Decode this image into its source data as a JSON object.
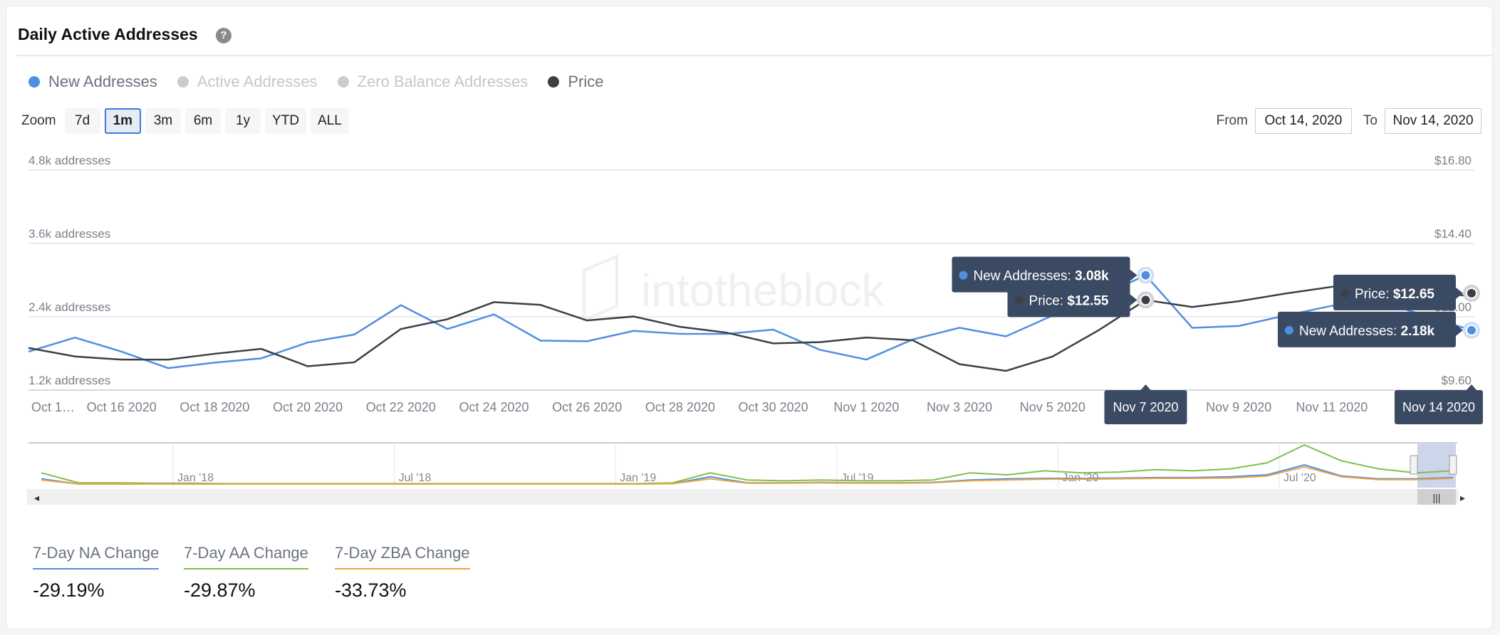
{
  "header": {
    "title": "Daily Active Addresses",
    "help_icon": "question-circle-icon"
  },
  "legend": [
    {
      "label": "New Addresses",
      "color": "#4f8fe0",
      "active": true
    },
    {
      "label": "Active Addresses",
      "color": "#cccccc",
      "active": false
    },
    {
      "label": "Zero Balance Addresses",
      "color": "#cccccc",
      "active": false
    },
    {
      "label": "Price",
      "color": "#3c3f44",
      "active": true
    }
  ],
  "legend_text": {
    "active": "#6b7380",
    "inactive": "#c4c7cc"
  },
  "zoom": {
    "label": "Zoom",
    "options": [
      "7d",
      "1m",
      "3m",
      "6m",
      "1y",
      "YTD",
      "ALL"
    ],
    "selected": "1m"
  },
  "range": {
    "from_label": "From",
    "from": "Oct 14, 2020",
    "to_label": "To",
    "to": "Nov 14, 2020"
  },
  "watermark": "intotheblock",
  "chart_data": {
    "type": "line",
    "x": [
      "Oct 14 2020",
      "Oct 15 2020",
      "Oct 16 2020",
      "Oct 17 2020",
      "Oct 18 2020",
      "Oct 19 2020",
      "Oct 20 2020",
      "Oct 21 2020",
      "Oct 22 2020",
      "Oct 23 2020",
      "Oct 24 2020",
      "Oct 25 2020",
      "Oct 26 2020",
      "Oct 27 2020",
      "Oct 28 2020",
      "Oct 29 2020",
      "Oct 30 2020",
      "Oct 31 2020",
      "Nov 1 2020",
      "Nov 2 2020",
      "Nov 3 2020",
      "Nov 4 2020",
      "Nov 5 2020",
      "Nov 6 2020",
      "Nov 7 2020",
      "Nov 8 2020",
      "Nov 9 2020",
      "Nov 10 2020",
      "Nov 11 2020",
      "Nov 12 2020",
      "Nov 13 2020",
      "Nov 14 2020"
    ],
    "x_tick_labels": [
      "Oct 1…",
      "Oct 16 2020",
      "Oct 18 2020",
      "Oct 20 2020",
      "Oct 22 2020",
      "Oct 24 2020",
      "Oct 26 2020",
      "Oct 28 2020",
      "Oct 30 2020",
      "Nov 1 2020",
      "Nov 3 2020",
      "Nov 5 2020",
      "Nov 7 2020",
      "Nov 9 2020",
      "Nov 11 2020",
      "N"
    ],
    "series": [
      {
        "name": "New Addresses",
        "axis": "left",
        "unit": "k",
        "color": "#4f8fe0",
        "values": [
          1.83,
          2.06,
          1.83,
          1.56,
          1.65,
          1.72,
          1.98,
          2.11,
          2.59,
          2.2,
          2.44,
          2.01,
          2.0,
          2.17,
          2.12,
          2.12,
          2.19,
          1.86,
          1.7,
          2.03,
          2.22,
          2.08,
          2.42,
          2.73,
          3.08,
          2.22,
          2.25,
          2.42,
          2.58,
          2.66,
          2.42,
          2.18
        ]
      },
      {
        "name": "Price",
        "axis": "right",
        "unit": "$",
        "color": "#3c3f44",
        "values": [
          10.98,
          10.7,
          10.6,
          10.6,
          10.79,
          10.95,
          10.38,
          10.51,
          11.6,
          11.92,
          12.48,
          12.39,
          11.88,
          12.01,
          11.67,
          11.48,
          11.13,
          11.17,
          11.32,
          11.23,
          10.45,
          10.23,
          10.7,
          11.57,
          12.55,
          12.32,
          12.51,
          12.76,
          12.98,
          13.17,
          12.92,
          12.65
        ]
      }
    ],
    "y_left": {
      "ticks": [
        "1.2k addresses",
        "2.4k addresses",
        "3.6k addresses",
        "4.8k addresses"
      ],
      "range": [
        1.2,
        4.8
      ]
    },
    "y_right": {
      "ticks": [
        "$9.60",
        "$12.00",
        "$14.40",
        "$16.80"
      ],
      "range": [
        9.6,
        16.8
      ]
    },
    "grid": true,
    "tooltips": [
      {
        "date": "Nov 7 2020",
        "new_label": "New Addresses: ",
        "new_value": "3.08k",
        "price_label": "Price: ",
        "price_value": "$12.55",
        "index": 24
      },
      {
        "date": "Nov 14 2020",
        "new_label": "New Addresses: ",
        "new_value": "2.18k",
        "price_label": "Price: ",
        "price_value": "$12.65",
        "index": 31
      }
    ],
    "navigator": {
      "labels": [
        "Jan '18",
        "Jul '18",
        "Jan '19",
        "Jul '19",
        "Jan '20",
        "Jul '20"
      ],
      "green": [
        0.3,
        0.05,
        0.05,
        0.04,
        0.04,
        0.03,
        0.03,
        0.03,
        0.03,
        0.03,
        0.03,
        0.03,
        0.03,
        0.03,
        0.03,
        0.03,
        0.03,
        0.05,
        0.3,
        0.12,
        0.1,
        0.12,
        0.1,
        0.1,
        0.12,
        0.3,
        0.25,
        0.35,
        0.3,
        0.32,
        0.38,
        0.35,
        0.4,
        0.55,
        1.0,
        0.6,
        0.4,
        0.3,
        0.35
      ],
      "blue": [
        0.15,
        0.02,
        0.02,
        0.02,
        0.02,
        0.02,
        0.02,
        0.02,
        0.02,
        0.02,
        0.02,
        0.02,
        0.02,
        0.02,
        0.02,
        0.02,
        0.02,
        0.03,
        0.2,
        0.05,
        0.05,
        0.06,
        0.05,
        0.05,
        0.06,
        0.12,
        0.15,
        0.16,
        0.16,
        0.17,
        0.18,
        0.18,
        0.2,
        0.25,
        0.5,
        0.22,
        0.15,
        0.15,
        0.18
      ],
      "orange": [
        0.12,
        0.02,
        0.02,
        0.02,
        0.02,
        0.02,
        0.02,
        0.02,
        0.02,
        0.02,
        0.02,
        0.02,
        0.02,
        0.02,
        0.02,
        0.02,
        0.02,
        0.03,
        0.15,
        0.04,
        0.04,
        0.05,
        0.04,
        0.04,
        0.05,
        0.1,
        0.12,
        0.14,
        0.14,
        0.15,
        0.16,
        0.16,
        0.17,
        0.22,
        0.45,
        0.2,
        0.13,
        0.13,
        0.16
      ]
    }
  },
  "stats": [
    {
      "label": "7-Day NA Change",
      "value": "-29.19%",
      "color": "#4f8fe0"
    },
    {
      "label": "7-Day AA Change",
      "value": "-29.87%",
      "color": "#7cc04f"
    },
    {
      "label": "7-Day ZBA Change",
      "value": "-33.73%",
      "color": "#f0a640"
    }
  ]
}
